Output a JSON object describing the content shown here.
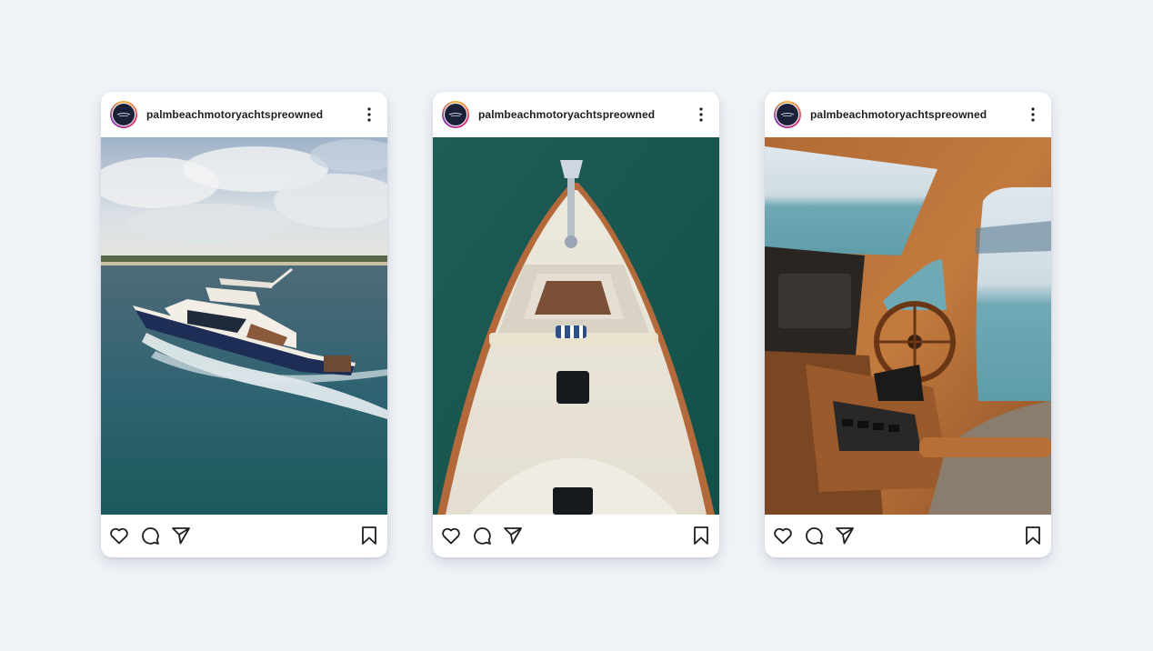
{
  "posts": [
    {
      "username": "palmbeachmotoryachtspreowned",
      "image": "motor yacht cruising at speed on open water"
    },
    {
      "username": "palmbeachmotoryachtspreowned",
      "image": "aerial view of yacht bow with cream deck over green water"
    },
    {
      "username": "palmbeachmotoryachtspreowned",
      "image": "teak wood helm station with wheel and ocean view"
    }
  ],
  "icons": {
    "avatar": "brand-logo-icon",
    "more": "more-vertical-icon",
    "like": "heart-icon",
    "comment": "comment-icon",
    "share": "send-icon",
    "save": "bookmark-icon"
  },
  "colors": {
    "background": "#eff3f8",
    "card": "#ffffff",
    "text": "#1e1e1e",
    "avatar_ring": "#e1306c"
  }
}
